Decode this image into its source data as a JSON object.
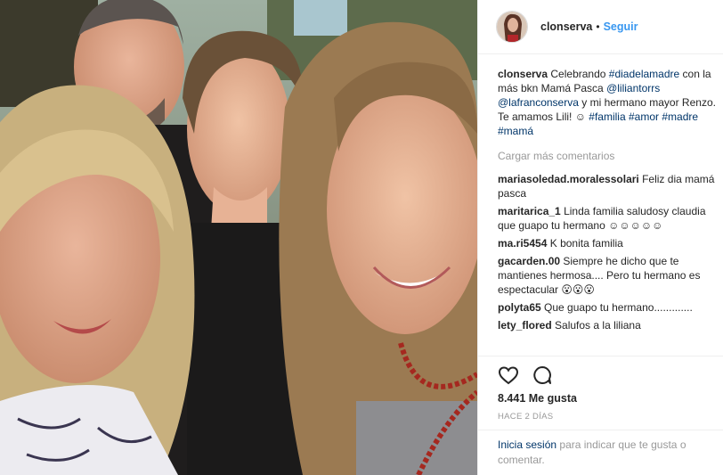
{
  "header": {
    "username": "clonserva",
    "dot": "•",
    "follow_label": "Seguir"
  },
  "caption": {
    "username": "clonserva",
    "text_1": "Celebrando",
    "hashtag_1": "#diadelamadre",
    "text_2": "con la más bkn Mamá Pasca",
    "mention_1": "@liliantorrs",
    "mention_2": "@lafranconserva",
    "text_3": "y mi hermano mayor Renzo.",
    "text_4": "Te amamos Lili! ☺",
    "hashtags": [
      "#familia",
      "#amor",
      "#madre",
      "#mamá"
    ]
  },
  "load_more_label": "Cargar más comentarios",
  "comments": [
    {
      "user": "mariasoledad.moralessolari",
      "text": "Feliz dia mamá pasca"
    },
    {
      "user": "maritarica_1",
      "text": "Linda familia saludosy claudia que guapo tu hermano ☺☺☺☺☺"
    },
    {
      "user": "ma.ri5454",
      "text": "K bonita familia"
    },
    {
      "user": "gacarden.00",
      "text": "Siempre he dicho que te mantienes hermosa.... Pero tu hermano es espectacular 😮😮😮"
    },
    {
      "user": "polyta65",
      "text": "Que guapo tu hermano............."
    },
    {
      "user": "lety_flored",
      "text": "Salufos a la liliana"
    }
  ],
  "likes_label": "8.441 Me gusta",
  "time_ago": "HACE 2 DÍAS",
  "login": {
    "link": "Inicia sesión",
    "text": "para indicar que te gusta o comentar."
  },
  "icons": {
    "like": "heart-outline-icon",
    "comment": "speech-bubble-icon"
  },
  "colors": {
    "link_blue": "#3897f0",
    "tag_blue": "#003569",
    "muted": "#999999"
  }
}
